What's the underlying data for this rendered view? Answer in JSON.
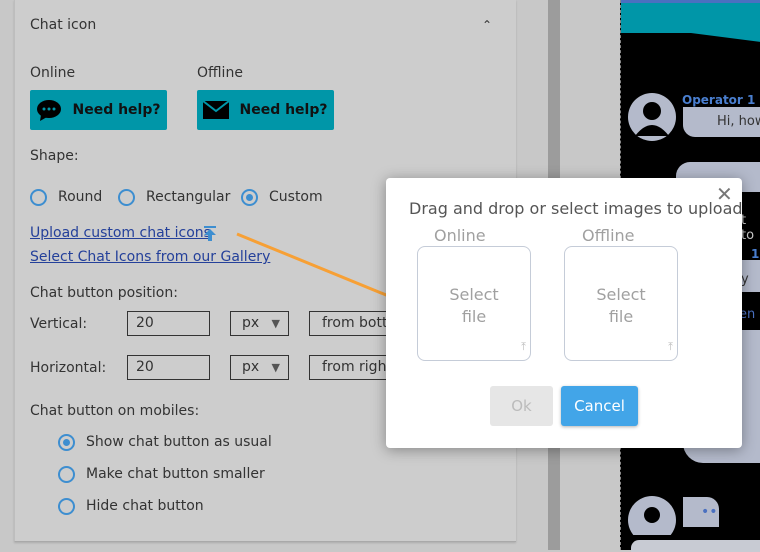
{
  "section": {
    "title": "Chat icon",
    "online_label": "Online",
    "offline_label": "Offline",
    "online_button": "Need help?",
    "offline_button": "Need help?"
  },
  "shape": {
    "label": "Shape:",
    "options": [
      "Round",
      "Rectangular",
      "Custom"
    ],
    "selected": "Custom"
  },
  "links": {
    "upload": "Upload custom chat icons",
    "gallery": "Select Chat Icons from our Gallery"
  },
  "position": {
    "label": "Chat button position:",
    "vertical_label": "Vertical:",
    "vertical_value": "20",
    "vertical_unit": "px",
    "vertical_from": "from bottom",
    "horizontal_label": "Horizontal:",
    "horizontal_value": "20",
    "horizontal_unit": "px",
    "horizontal_from": "from right"
  },
  "mobiles": {
    "label": "Chat button on mobiles:",
    "options": [
      "Show chat button as usual",
      "Make chat button smaller",
      "Hide chat button"
    ],
    "selected": "Show chat button as usual"
  },
  "preview": {
    "operator": "Operator 1",
    "time": "1",
    "message": "Hi, how",
    "partial1": "t to",
    "partial2": "1",
    "partial3": "y",
    "partial4": "en"
  },
  "modal": {
    "title": "Drag and drop or select images to upload",
    "online_label": "Online",
    "offline_label": "Offline",
    "select_file": "Select file",
    "ok": "Ok",
    "cancel": "Cancel"
  },
  "colors": {
    "accent": "#0096a8",
    "link": "#24409a",
    "radio": "#3d8ed0",
    "cancel": "#42a5e8",
    "arrow": "#f7a035"
  }
}
